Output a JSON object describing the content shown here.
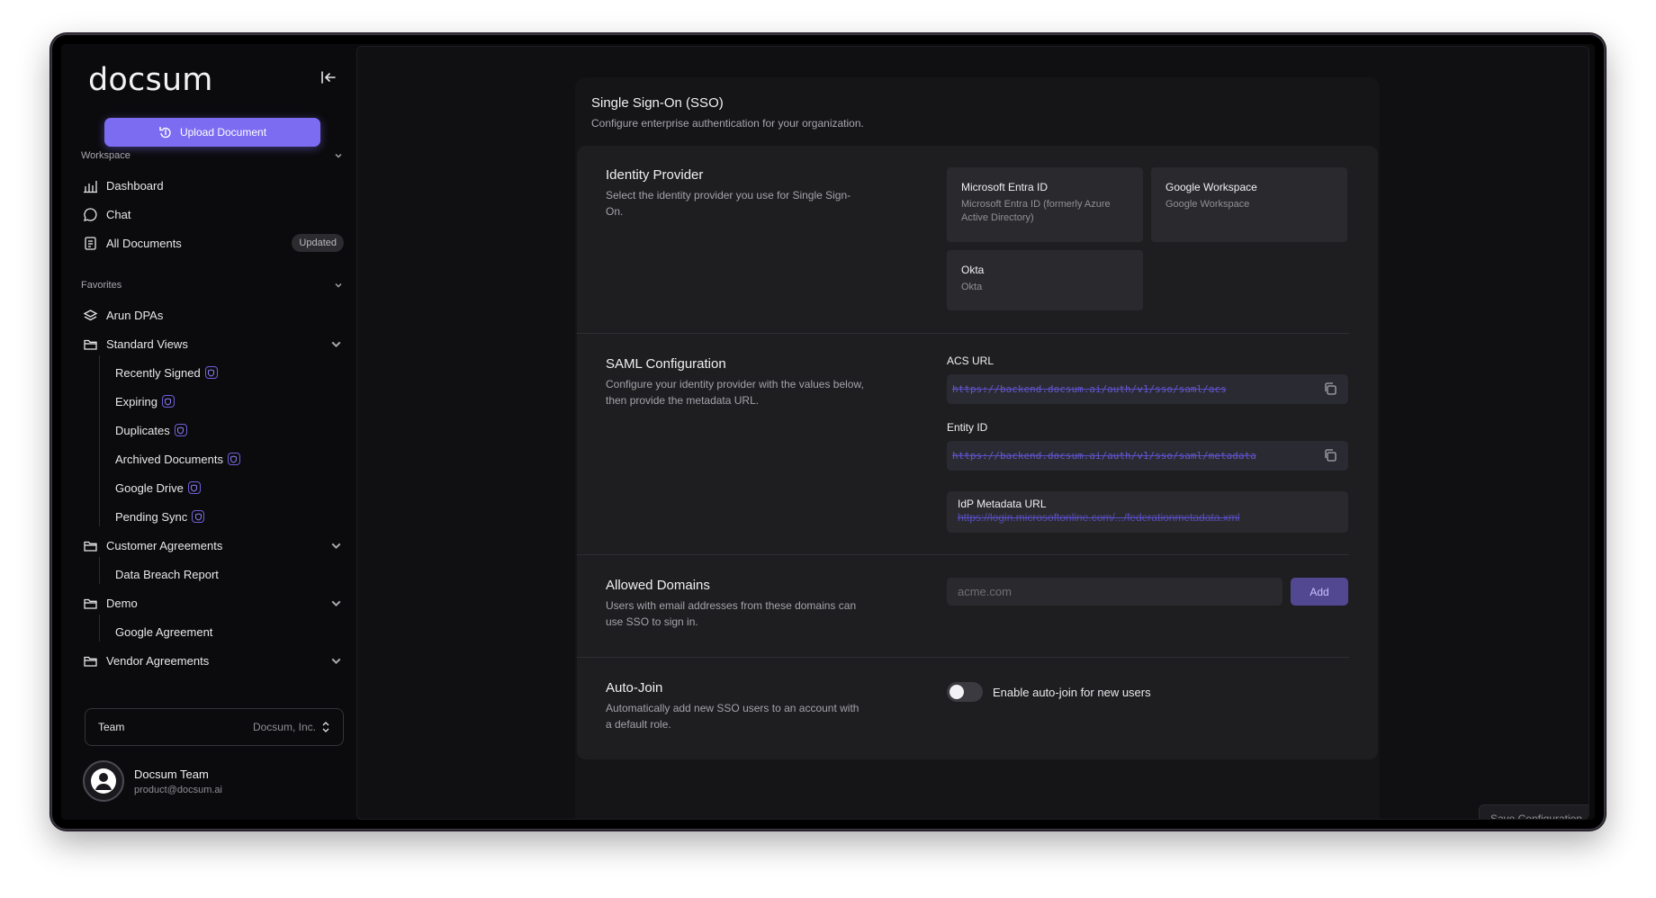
{
  "sidebar": {
    "logo": "docsum",
    "upload_label": "Upload Document",
    "workspace": {
      "label": "Workspace",
      "items": [
        {
          "label": "Dashboard",
          "icon": "chart-bar-icon"
        },
        {
          "label": "Chat",
          "icon": "chat-bubble-icon"
        },
        {
          "label": "All Documents",
          "icon": "documents-icon",
          "badge": "Updated"
        }
      ]
    },
    "favorites": {
      "label": "Favorites",
      "arun": "Arun DPAs",
      "standard_views": "Standard Views",
      "views": [
        "Recently Signed",
        "Expiring",
        "Duplicates",
        "Archived Documents",
        "Google Drive",
        "Pending Sync"
      ],
      "customer_agreements": "Customer Agreements",
      "customer_children": [
        "Data Breach Report"
      ],
      "demo": "Demo",
      "demo_children": [
        "Google Agreement"
      ],
      "vendor_agreements": "Vendor Agreements"
    },
    "team": {
      "label": "Team",
      "value": "Docsum, Inc."
    },
    "profile": {
      "name": "Docsum Team",
      "email": "product@docsum.ai"
    }
  },
  "sso": {
    "title": "Single Sign-On (SSO)",
    "subtitle": "Configure enterprise authentication for your organization.",
    "identity": {
      "title": "Identity Provider",
      "desc": "Select the identity provider you use for Single Sign-On.",
      "providers": [
        {
          "name": "Microsoft Entra ID",
          "desc": "Microsoft Entra ID (formerly Azure Active Directory)"
        },
        {
          "name": "Google Workspace",
          "desc": "Google Workspace"
        },
        {
          "name": "Okta",
          "desc": "Okta"
        }
      ]
    },
    "saml": {
      "title": "SAML Configuration",
      "desc": "Configure your identity provider with the values below, then provide the metadata URL.",
      "acs_label": "ACS URL",
      "acs_value": "https://backend.docsum.ai/auth/v1/sso/saml/acs",
      "entity_label": "Entity ID",
      "entity_value": "https://backend.docsum.ai/auth/v1/sso/saml/metadata",
      "idp_label": "IdP Metadata URL",
      "idp_value": "https://login.microsoftonline.com/.../federationmetadata.xml"
    },
    "domains": {
      "title": "Allowed Domains",
      "desc": "Users with email addresses from these domains can use SSO to sign in.",
      "placeholder": "acme.com",
      "add_label": "Add"
    },
    "autojoin": {
      "title": "Auto-Join",
      "desc": "Automatically add new SSO users to an account with a default role.",
      "toggle_label": "Enable auto-join for new users",
      "enabled": false
    },
    "save_label": "Save Configuration"
  },
  "colors": {
    "accent": "#7c6cf2",
    "background": "#0b0b0d",
    "panel": "#1e1e21"
  }
}
